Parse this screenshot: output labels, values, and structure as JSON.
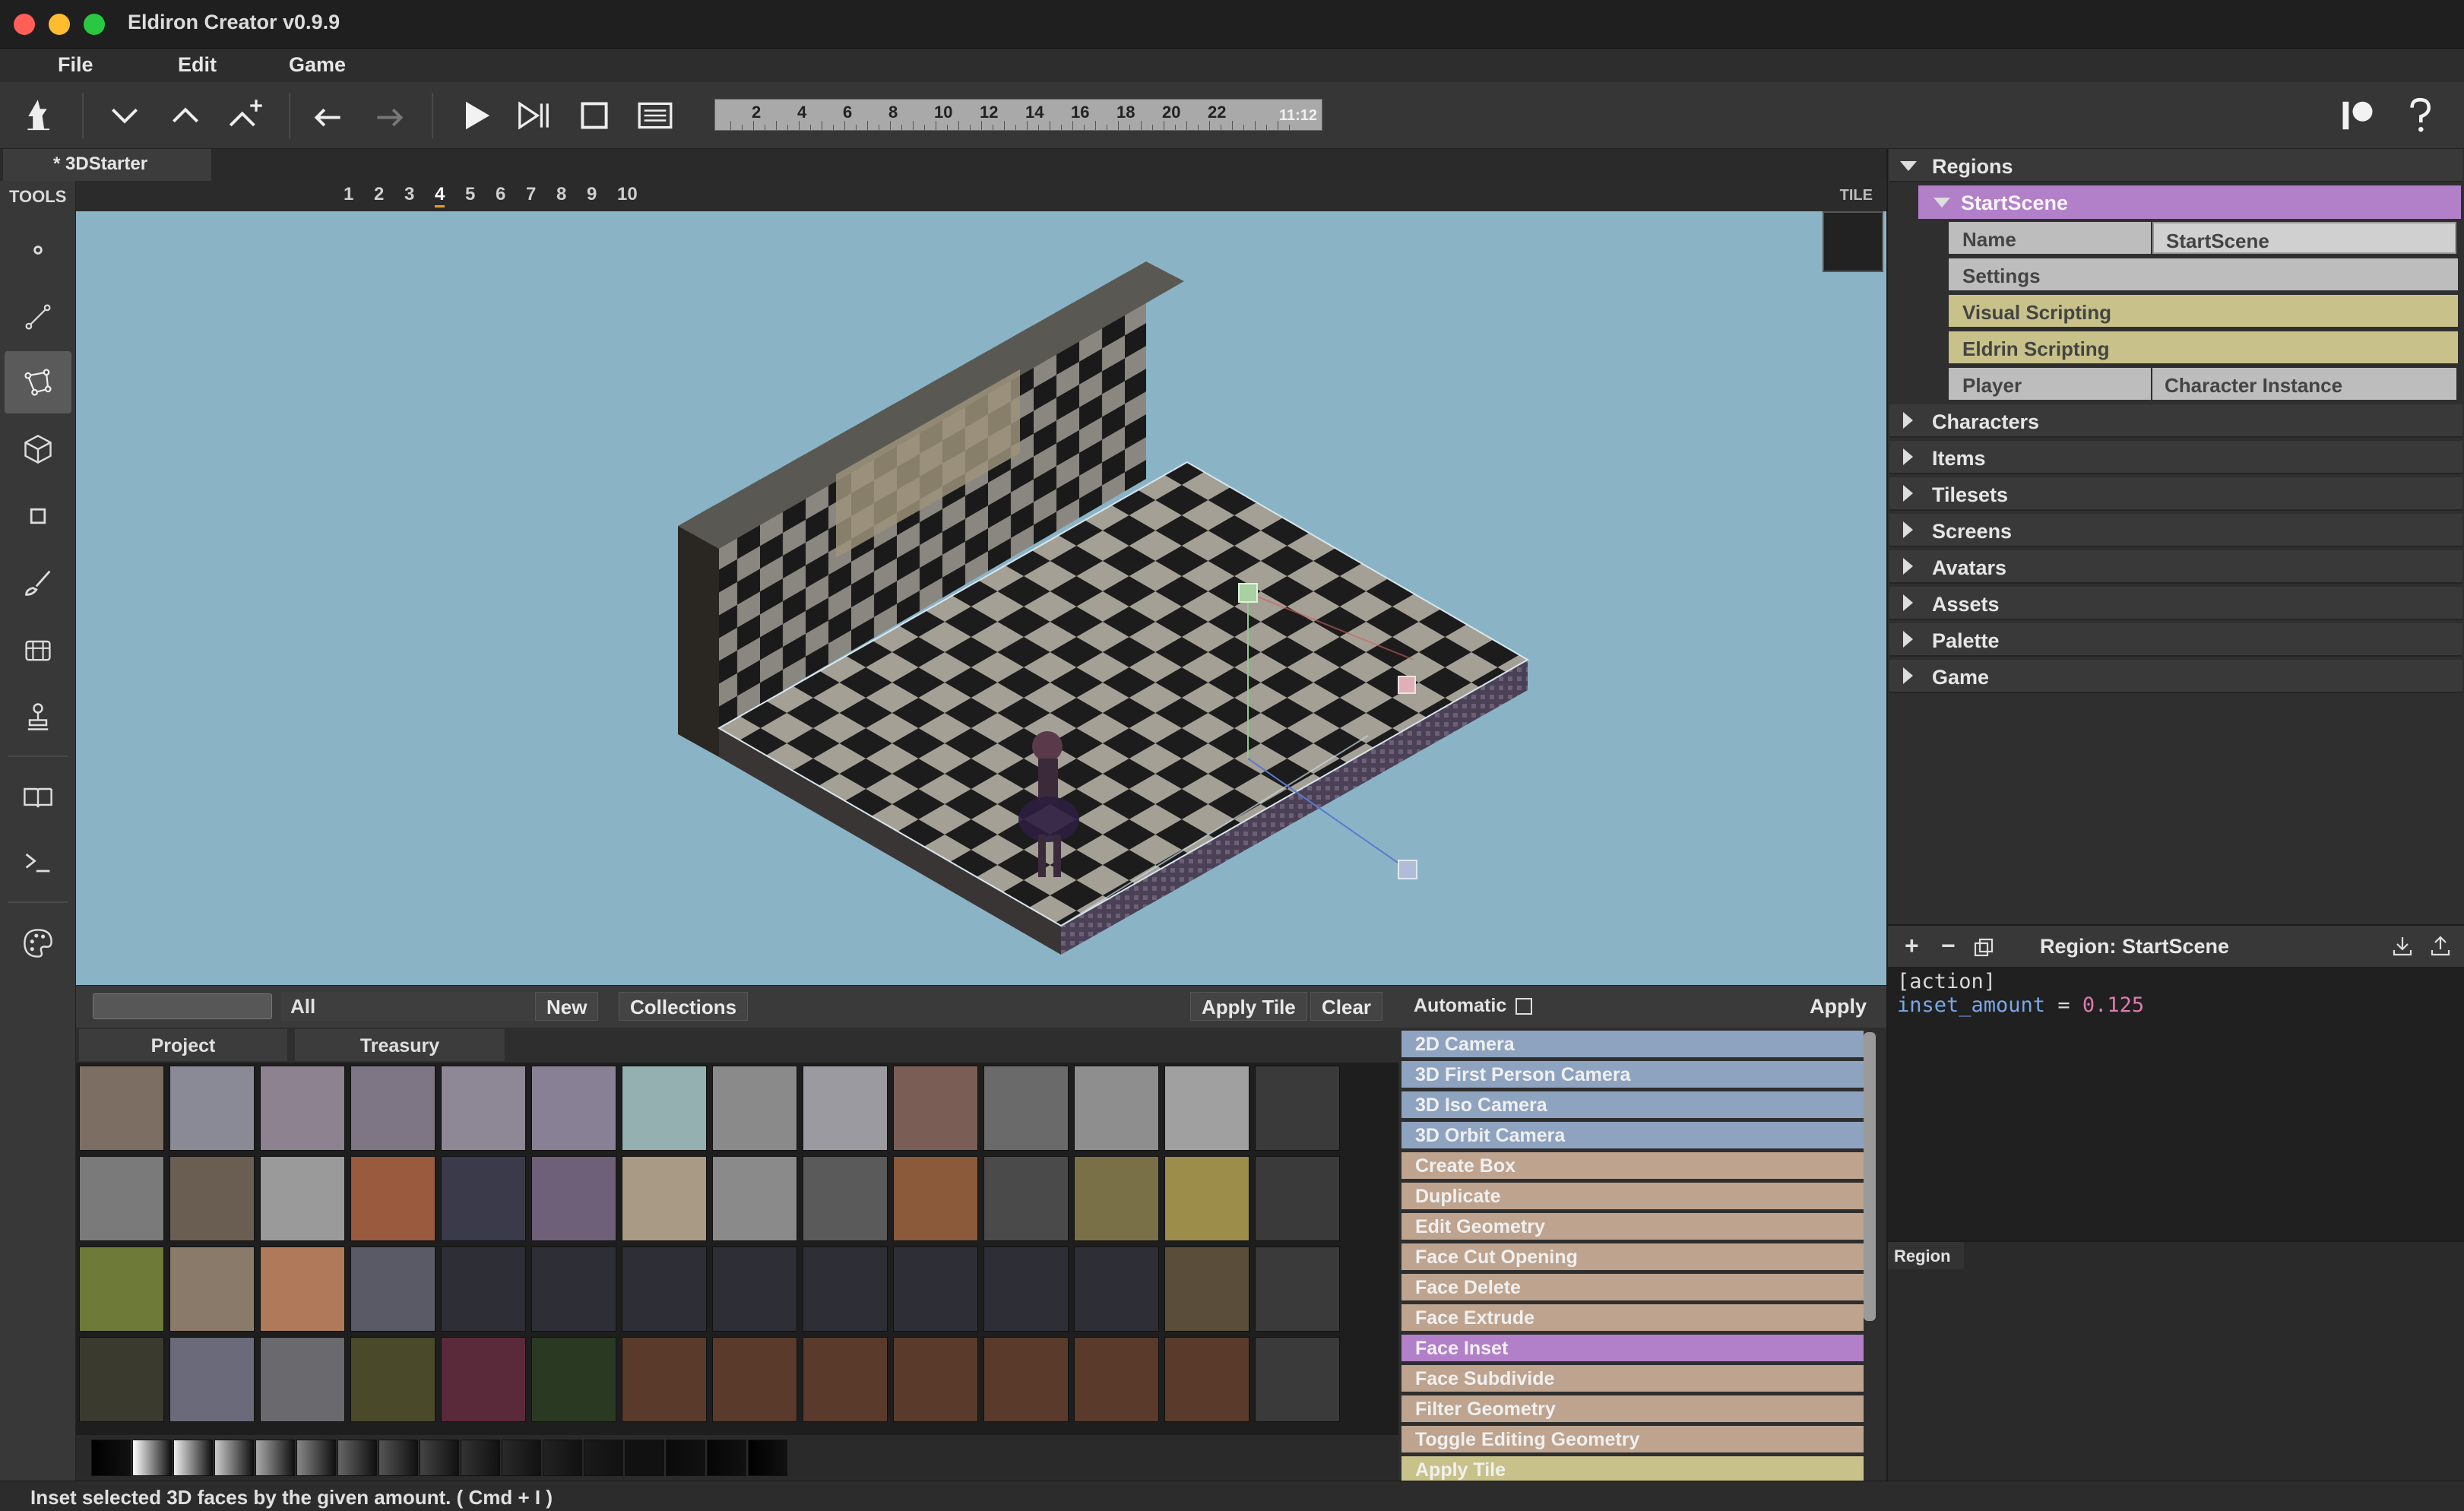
{
  "window": {
    "title": "Eldiron Creator v0.9.9"
  },
  "menu": {
    "file": "File",
    "edit": "Edit",
    "game": "Game"
  },
  "timeline": {
    "ticks": [
      "2",
      "4",
      "6",
      "8",
      "10",
      "12",
      "14",
      "16",
      "18",
      "20",
      "22"
    ],
    "time": "11:12"
  },
  "tab": {
    "document": "* 3DStarter"
  },
  "tools": {
    "header": "TOOLS"
  },
  "viewport": {
    "layers": [
      "1",
      "2",
      "3",
      "4",
      "5",
      "6",
      "7",
      "8",
      "9",
      "10"
    ],
    "active_layer": "4",
    "tile_label": "TILE"
  },
  "tile_browser": {
    "filter": "All",
    "new_label": "New",
    "collections_label": "Collections",
    "apply_tile_label": "Apply Tile",
    "clear_label": "Clear",
    "tabs": [
      "Project",
      "Treasury"
    ]
  },
  "actions": {
    "automatic_label": "Automatic",
    "apply_label": "Apply",
    "items": [
      {
        "label": "2D Camera",
        "kind": "cam"
      },
      {
        "label": "3D First Person Camera",
        "kind": "cam"
      },
      {
        "label": "3D Iso Camera",
        "kind": "cam"
      },
      {
        "label": "3D Orbit Camera",
        "kind": "cam"
      },
      {
        "label": "Create Box",
        "kind": "geo"
      },
      {
        "label": "Duplicate",
        "kind": "geo"
      },
      {
        "label": "Edit Geometry",
        "kind": "geo"
      },
      {
        "label": "Face Cut Opening",
        "kind": "geo"
      },
      {
        "label": "Face Delete",
        "kind": "geo"
      },
      {
        "label": "Face Extrude",
        "kind": "geo"
      },
      {
        "label": "Face Inset",
        "kind": "sel"
      },
      {
        "label": "Face Subdivide",
        "kind": "geo"
      },
      {
        "label": "Filter Geometry",
        "kind": "geo"
      },
      {
        "label": "Toggle Editing Geometry",
        "kind": "geo"
      },
      {
        "label": "Apply Tile",
        "kind": "tile"
      }
    ]
  },
  "project_tree": {
    "regions": "Regions",
    "selected_region": "StartScene",
    "props": [
      {
        "key": "Name",
        "value": "StartScene",
        "color": "#bdbdbd"
      },
      {
        "key": "Settings",
        "value": "",
        "color": "#bdbdbd"
      },
      {
        "key": "Visual Scripting",
        "value": "",
        "color": "#c8c28a"
      },
      {
        "key": "Eldrin Scripting",
        "value": "",
        "color": "#c8c28a"
      },
      {
        "key": "Player",
        "value": "Character Instance",
        "color": "#bdbdbd"
      }
    ],
    "sections": [
      "Characters",
      "Items",
      "Tilesets",
      "Screens",
      "Avatars",
      "Assets",
      "Palette",
      "Game"
    ]
  },
  "region_panel": {
    "title": "Region: StartScene",
    "code_section": "[action]",
    "code_key": "inset_amount",
    "code_op": "=",
    "code_value": "0.125",
    "bottom_tab": "Region"
  },
  "status": {
    "text": "Inset selected 3D faces by the given amount. ( Cmd + I )"
  },
  "colors": {
    "accent_purple": "#b27fc9",
    "camera_blue": "#8ea3c0",
    "geometry_tan": "#bea38e",
    "tile_yellow": "#c8c28a",
    "viewport_bg": "#8ab4c6"
  }
}
